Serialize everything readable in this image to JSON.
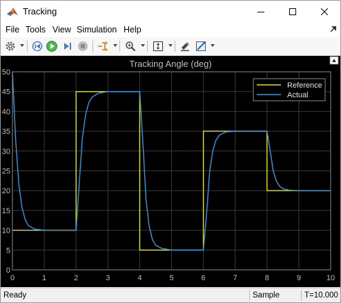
{
  "window": {
    "title": "Tracking",
    "controls": [
      "minimize",
      "maximize",
      "close"
    ]
  },
  "menu": [
    "File",
    "Tools",
    "View",
    "Simulation",
    "Help"
  ],
  "toolbar": {
    "icons": [
      "gear-icon",
      "step-back-icon",
      "run-icon",
      "step-forward-icon",
      "stop-icon",
      "signal-select-icon",
      "zoom-icon",
      "fit-axes-icon",
      "highlight-icon",
      "style-icon"
    ]
  },
  "status": {
    "left": "Ready",
    "mode": "Sample based",
    "time": "T=10.000"
  },
  "colors": {
    "reference": "#e5e224",
    "actual": "#2f9be0",
    "axes_bg": "#000000",
    "grid": "#3a3a3a",
    "text": "#bfbfbf"
  },
  "chart_data": {
    "type": "line",
    "title": "Tracking Angle (deg)",
    "xlim": [
      0,
      10
    ],
    "ylim": [
      0,
      50
    ],
    "xticks": [
      "0",
      "1",
      "2",
      "3",
      "4",
      "5",
      "6",
      "7",
      "8",
      "9",
      "10"
    ],
    "yticks": [
      "0",
      "5",
      "10",
      "15",
      "20",
      "25",
      "30",
      "35",
      "40",
      "45",
      "50"
    ],
    "grid": true,
    "legend_position": "top-right",
    "series": [
      {
        "name": "Reference",
        "color": "#e5e224",
        "step": true,
        "x": [
          0,
          2,
          2,
          4,
          4,
          6,
          6,
          8,
          8,
          10
        ],
        "y": [
          10,
          10,
          45,
          45,
          5,
          5,
          35,
          35,
          20,
          20
        ]
      },
      {
        "name": "Actual",
        "color": "#2f9be0",
        "x": [
          0,
          0.1,
          0.2,
          0.3,
          0.4,
          0.5,
          0.7,
          1.0,
          2.0,
          2.1,
          2.2,
          2.3,
          2.4,
          2.5,
          2.7,
          3.0,
          4.0,
          4.1,
          4.2,
          4.3,
          4.4,
          4.5,
          4.7,
          5.0,
          6.0,
          6.1,
          6.2,
          6.3,
          6.4,
          6.5,
          6.7,
          7.0,
          8.0,
          8.1,
          8.2,
          8.3,
          8.4,
          8.5,
          8.7,
          9.0,
          10.0
        ],
        "y": [
          50,
          33.0,
          21.7,
          15.8,
          12.7,
          11.2,
          10.3,
          10.0,
          10,
          22.0,
          33.5,
          39.2,
          42.2,
          43.6,
          44.6,
          45.0,
          45,
          32.0,
          17.6,
          10.9,
          7.6,
          6.2,
          5.4,
          5.0,
          5,
          14.0,
          25.0,
          30.2,
          32.8,
          34.0,
          34.8,
          35.0,
          35,
          30.0,
          24.8,
          22.3,
          21.1,
          20.5,
          20.1,
          20.0,
          20.0
        ]
      }
    ]
  }
}
